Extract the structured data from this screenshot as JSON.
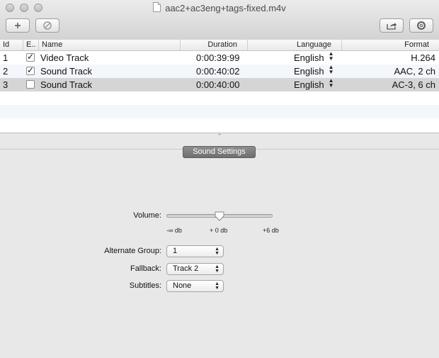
{
  "window": {
    "title": "aac2+ac3eng+tags-fixed.m4v"
  },
  "toolbar": {
    "add_icon": "plus-icon",
    "remove_icon": "prohibited-icon",
    "share_icon": "share-icon",
    "info_icon": "inspector-icon"
  },
  "table": {
    "columns": {
      "id": "Id",
      "enabled": "E..",
      "name": "Name",
      "duration": "Duration",
      "language": "Language",
      "format": "Format"
    },
    "rows": [
      {
        "id": "1",
        "enabled": true,
        "name": "Video Track",
        "duration": "0:00:39:99",
        "language": "English",
        "format": "H.264"
      },
      {
        "id": "2",
        "enabled": true,
        "name": "Sound Track",
        "duration": "0:00:40:02",
        "language": "English",
        "format": "AAC, 2 ch"
      },
      {
        "id": "3",
        "enabled": false,
        "name": "Sound Track",
        "duration": "0:00:40:00",
        "language": "English",
        "format": "AC-3, 6 ch"
      }
    ],
    "selected_row": 3
  },
  "settings": {
    "header": "Sound Settings",
    "volume": {
      "label": "Volume:",
      "min_label": "-∞ db",
      "mid_label": "+ 0 db",
      "max_label": "+6 db",
      "value_db": 0
    },
    "alternate_group": {
      "label": "Alternate Group:",
      "value": "1"
    },
    "fallback": {
      "label": "Fallback:",
      "value": "Track 2"
    },
    "subtitles": {
      "label": "Subtitles:",
      "value": "None"
    }
  }
}
